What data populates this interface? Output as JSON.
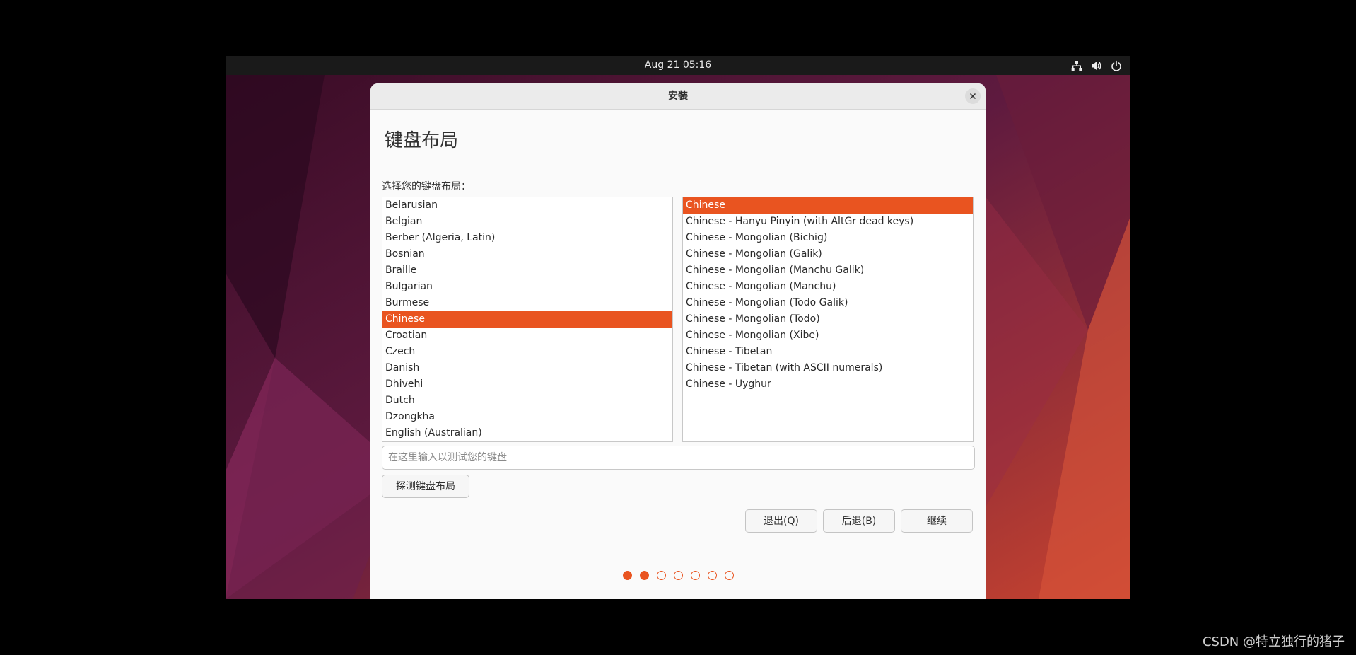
{
  "topbar": {
    "datetime": "Aug 21  05:16"
  },
  "tray_icons": [
    "network-icon",
    "volume-icon",
    "power-icon"
  ],
  "dialog": {
    "title": "安装",
    "heading": "键盘布局",
    "prompt": "选择您的键盘布局：",
    "layouts": [
      "Belarusian",
      "Belgian",
      "Berber (Algeria, Latin)",
      "Bosnian",
      "Braille",
      "Bulgarian",
      "Burmese",
      "Chinese",
      "Croatian",
      "Czech",
      "Danish",
      "Dhivehi",
      "Dutch",
      "Dzongkha",
      "English (Australian)"
    ],
    "selected_layout": "Chinese",
    "variants": [
      "Chinese",
      "Chinese - Hanyu Pinyin (with AltGr dead keys)",
      "Chinese - Mongolian (Bichig)",
      "Chinese - Mongolian (Galik)",
      "Chinese - Mongolian (Manchu Galik)",
      "Chinese - Mongolian (Manchu)",
      "Chinese - Mongolian (Todo Galik)",
      "Chinese - Mongolian (Todo)",
      "Chinese - Mongolian (Xibe)",
      "Chinese - Tibetan",
      "Chinese - Tibetan (with ASCII numerals)",
      "Chinese - Uyghur"
    ],
    "selected_variant": "Chinese",
    "test_placeholder": "在这里输入以测试您的键盘",
    "test_value": "",
    "detect_label": "探测键盘布局",
    "quit_label": "退出(Q)",
    "back_label": "后退(B)",
    "continue_label": "继续",
    "progress": {
      "current_step": 2,
      "total_steps": 7
    }
  },
  "colors": {
    "accent": "#e95420",
    "topbar": "#1a1a1a",
    "dialog_bg": "#fafafa"
  },
  "watermark": "CSDN @特立独行的猪子"
}
